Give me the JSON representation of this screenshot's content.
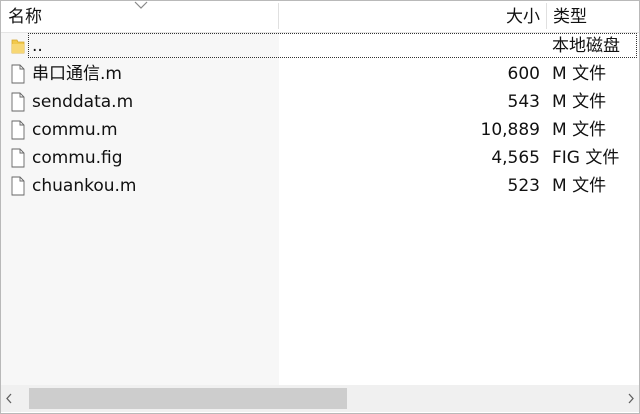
{
  "columns": {
    "name": "名称",
    "size": "大小",
    "type": "类型"
  },
  "rows": [
    {
      "name": "..",
      "size": "",
      "type": "本地磁盘",
      "icon": "folder-icon"
    },
    {
      "name": "串口通信.m",
      "size": "600",
      "type": "M 文件",
      "icon": "file-icon"
    },
    {
      "name": "senddata.m",
      "size": "543",
      "type": "M 文件",
      "icon": "file-icon"
    },
    {
      "name": "commu.m",
      "size": "10,889",
      "type": "M 文件",
      "icon": "file-icon"
    },
    {
      "name": "commu.fig",
      "size": "4,565",
      "type": "FIG 文件",
      "icon": "file-icon"
    },
    {
      "name": "chuankou.m",
      "size": "523",
      "type": "M 文件",
      "icon": "file-icon"
    }
  ],
  "colors": {
    "folder": "#f2c94c",
    "name_column_bg": "#f7f7f7",
    "scroll_thumb": "#cdcdcd"
  },
  "sort": {
    "column": "name",
    "direction": "descending"
  }
}
